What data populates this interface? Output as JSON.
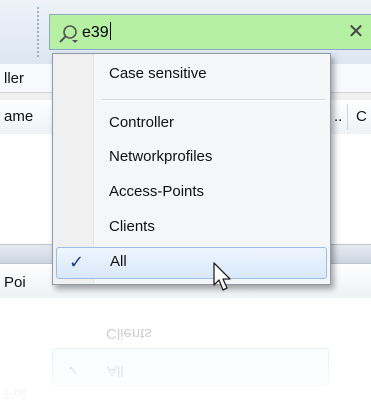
{
  "search": {
    "value": "e39",
    "clear_icon": "✕",
    "field_color": "#b6f0a3"
  },
  "background": {
    "tab_label": "ller",
    "column_header_label": "ame",
    "column_ellipsis": "..",
    "column_c": "C",
    "lower_label": "Poi"
  },
  "menu": {
    "case_sensitive": "Case sensitive",
    "items": [
      {
        "label": "Controller",
        "checked": false
      },
      {
        "label": "Networkprofiles",
        "checked": false
      },
      {
        "label": "Access-Points",
        "checked": false
      },
      {
        "label": "Clients",
        "checked": false
      },
      {
        "label": "All",
        "checked": true
      }
    ],
    "check_glyph": "✓",
    "selected_color": "#d9e8fa"
  }
}
